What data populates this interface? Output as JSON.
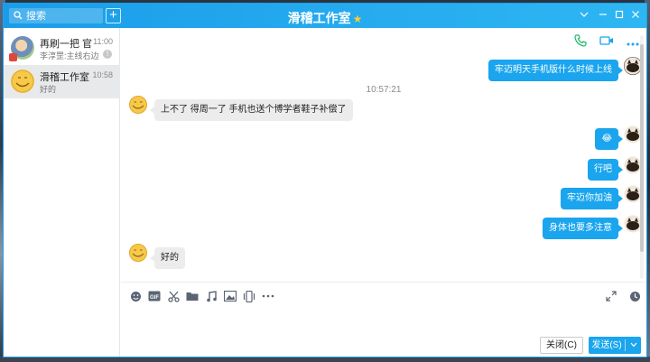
{
  "window": {
    "title": "滑稽工作室",
    "title_badge_icon": "star-icon"
  },
  "search": {
    "placeholder": "搜索"
  },
  "conversations": [
    {
      "name": "再刷一把 官方",
      "time": "11:00",
      "preview": "李淳罡:主线右边的",
      "badge": "!"
    },
    {
      "name": "滑稽工作室",
      "time": "10:58",
      "preview": "好的"
    }
  ],
  "chat": {
    "timestamp": "10:57:21",
    "messages": [
      {
        "from": "me",
        "text": "牢迈明天手机版什么时候上线"
      },
      {
        "from": "other",
        "text": "上不了 得周一了 手机也送个博学者鞋子补偿了"
      },
      {
        "from": "me",
        "text": "😂"
      },
      {
        "from": "me",
        "text": "行吧"
      },
      {
        "from": "me",
        "text": "牢迈你加油"
      },
      {
        "from": "me",
        "text": "身体也要多注意"
      },
      {
        "from": "other",
        "text": "好的"
      }
    ]
  },
  "toolbar": {
    "tools": [
      "emoji-icon",
      "gif-icon",
      "scissors-icon",
      "folder-icon",
      "music-icon",
      "image-icon",
      "shake-icon",
      "more-icon"
    ],
    "right": [
      "expand-icon",
      "history-clock-icon"
    ]
  },
  "actions": {
    "close_label": "关闭(C)",
    "send_label": "发送(S)"
  },
  "colors": {
    "accent": "#1aa5ee",
    "titlebar": "#1a9de9",
    "green_phone": "#1fb86b"
  }
}
